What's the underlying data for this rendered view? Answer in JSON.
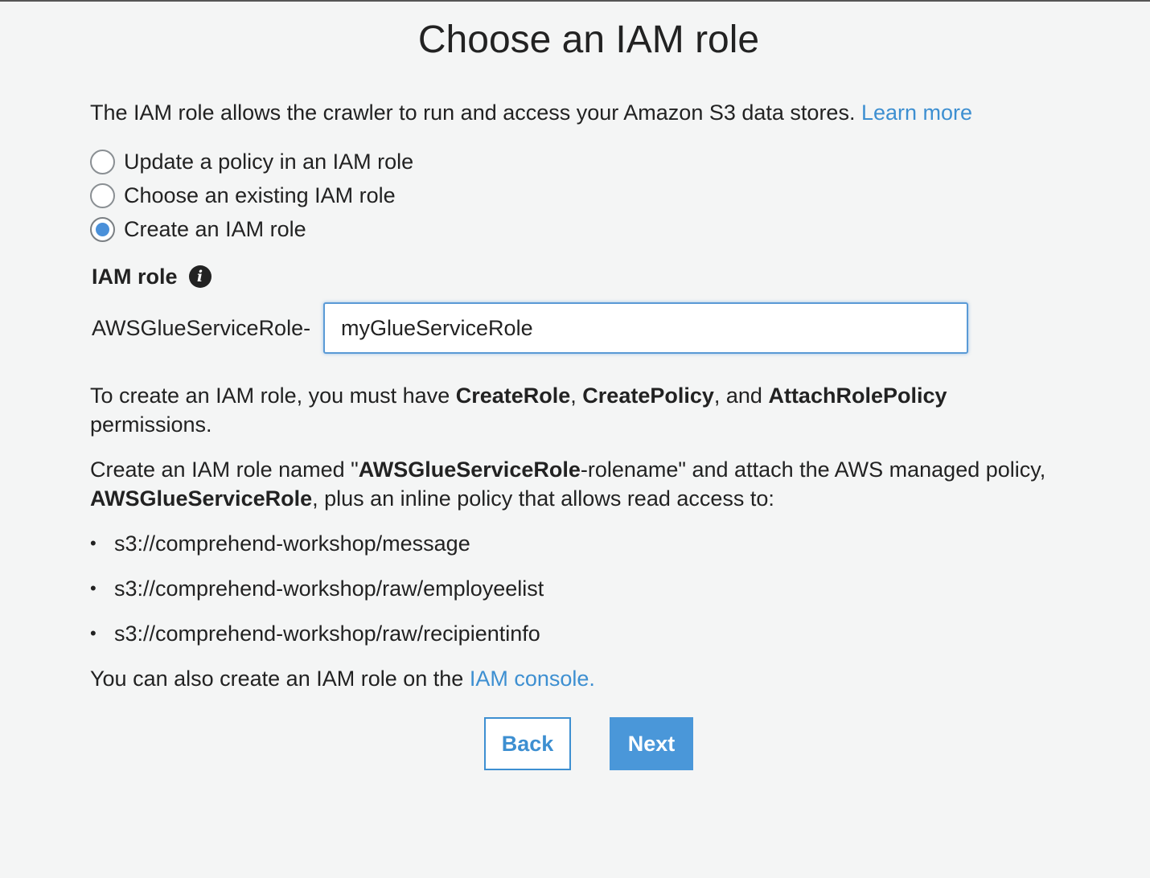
{
  "title": "Choose an IAM role",
  "intro": {
    "text": "The IAM role allows the crawler to run and access your Amazon S3 data stores.",
    "link": "Learn more"
  },
  "radios": [
    {
      "label": "Update a policy in an IAM role",
      "checked": false
    },
    {
      "label": "Choose an existing IAM role",
      "checked": false
    },
    {
      "label": "Create an IAM role",
      "checked": true
    }
  ],
  "iam_role": {
    "heading": "IAM role",
    "info_icon": "i",
    "prefix": "AWSGlueServiceRole-",
    "value": "myGlueServiceRole"
  },
  "permissions": {
    "t1": "To create an IAM role, you must have ",
    "b1": "CreateRole",
    "t2": ", ",
    "b2": "CreatePolicy",
    "t3": ", and ",
    "b3": "AttachRolePolicy",
    "t4": " permissions."
  },
  "create_info": {
    "t1": "Create an IAM role named \"",
    "b1": "AWSGlueServiceRole",
    "t2": "-rolename\" and attach the AWS managed policy, ",
    "b2": "AWSGlueServiceRole",
    "t3": ", plus an inline policy that allows read access to:"
  },
  "paths": [
    "s3://comprehend-workshop/message",
    "s3://comprehend-workshop/raw/employeelist",
    "s3://comprehend-workshop/raw/recipientinfo"
  ],
  "bullet": "•",
  "footer": {
    "text": "You can also create an IAM role on the ",
    "link": "IAM console."
  },
  "buttons": {
    "back": "Back",
    "next": "Next"
  },
  "colors": {
    "accent": "#3d8fd1",
    "primary_button": "#4a97d9",
    "background": "#f4f5f5"
  }
}
